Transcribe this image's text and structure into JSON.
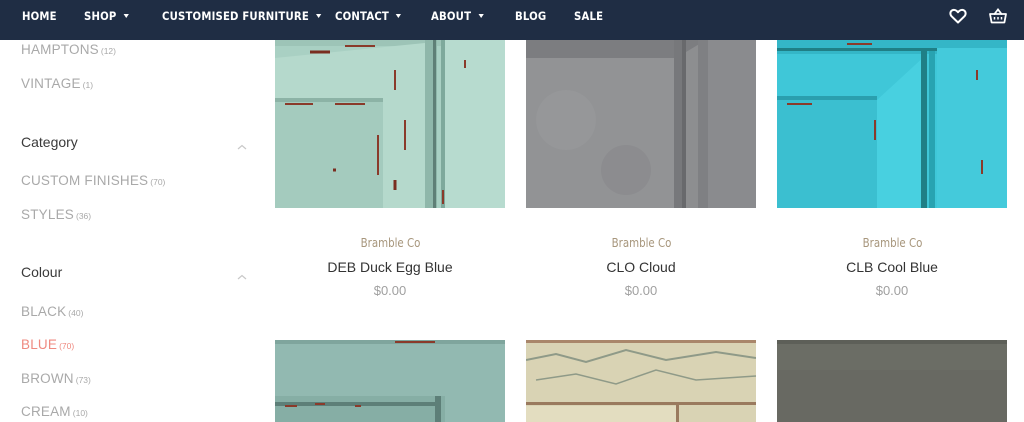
{
  "nav": {
    "items": [
      {
        "label": "HOME",
        "dropdown": false
      },
      {
        "label": "SHOP",
        "dropdown": true
      },
      {
        "label": "CUSTOMISED FURNITURE",
        "dropdown": true
      },
      {
        "label": "CONTACT",
        "dropdown": true
      },
      {
        "label": "ABOUT",
        "dropdown": true
      },
      {
        "label": "BLOG",
        "dropdown": false
      },
      {
        "label": "SALE",
        "dropdown": false
      }
    ],
    "icons": [
      "heart-icon",
      "basket-icon"
    ],
    "bg_color": "#1f2d44"
  },
  "sidebar": {
    "top_links": [
      {
        "label": "HAMPTONS",
        "count": "(12)"
      },
      {
        "label": "VINTAGE",
        "count": "(1)"
      }
    ],
    "category": {
      "title": "Category",
      "items": [
        {
          "label": "CUSTOM FINISHES",
          "count": "(70)"
        },
        {
          "label": "STYLES",
          "count": "(36)"
        }
      ]
    },
    "colour": {
      "title": "Colour",
      "items": [
        {
          "label": "BLACK",
          "count": "(40)",
          "active": false
        },
        {
          "label": "BLUE",
          "count": "(70)",
          "active": true
        },
        {
          "label": "BROWN",
          "count": "(73)",
          "active": false
        },
        {
          "label": "CREAM",
          "count": "(10)",
          "active": false
        }
      ]
    },
    "active_color": "#ef8a80"
  },
  "products": [
    {
      "brand": "Bramble Co",
      "name": "DEB Duck Egg Blue",
      "price": "$0.00",
      "swatch": "#a7cfc2"
    },
    {
      "brand": "Bramble Co",
      "name": "CLO Cloud",
      "price": "$0.00",
      "swatch": "#8a8b8d"
    },
    {
      "brand": "Bramble Co",
      "name": "CLB Cool Blue",
      "price": "$0.00",
      "swatch": "#3ac3d4"
    },
    {
      "swatch": "#8fb6ae"
    },
    {
      "swatch": "#d9d3b4"
    },
    {
      "swatch": "#6b6d65"
    }
  ]
}
